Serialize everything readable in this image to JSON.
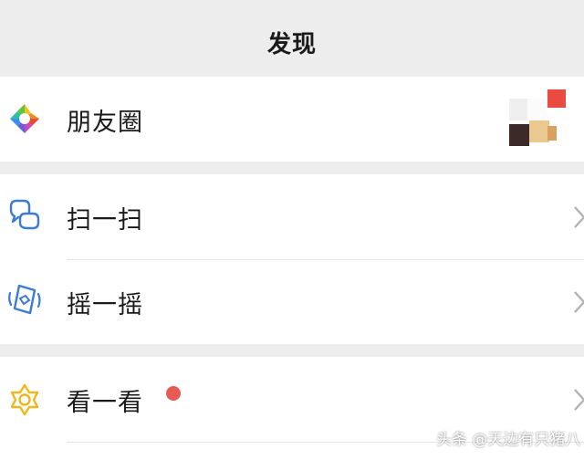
{
  "status_bar": {
    "left": "",
    "center": "",
    "right": ""
  },
  "header": {
    "title": "发现"
  },
  "menu": {
    "moments": {
      "label": "朋友圈",
      "icon": "moments-aperture-icon"
    },
    "scan": {
      "label": "扫一扫",
      "icon": "scan-icon"
    },
    "shake": {
      "label": "摇一摇",
      "icon": "shake-icon"
    },
    "top_stories": {
      "label": "看一看",
      "icon": "top-stories-icon",
      "badge": "red-dot"
    }
  },
  "watermark": "头条 @天边有只猪八",
  "colors": {
    "background": "#ededed",
    "card": "#ffffff",
    "accent_blue": "#3a7bd5",
    "badge_red": "#e85b54",
    "gold": "#f0b71d"
  }
}
